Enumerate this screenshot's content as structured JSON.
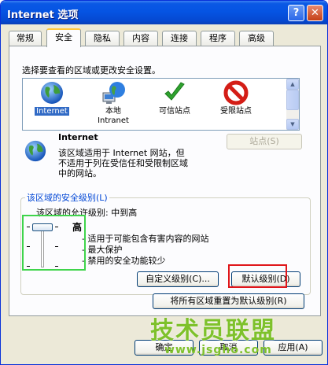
{
  "window": {
    "title": "Internet 选项",
    "help_glyph": "?",
    "close_glyph": "✕"
  },
  "tabs": [
    {
      "label": "常规",
      "active": false
    },
    {
      "label": "安全",
      "active": true
    },
    {
      "label": "隐私",
      "active": false
    },
    {
      "label": "内容",
      "active": false
    },
    {
      "label": "连接",
      "active": false
    },
    {
      "label": "程序",
      "active": false
    },
    {
      "label": "高级",
      "active": false
    }
  ],
  "security": {
    "instruction": "选择要查看的区域或更改安全设置。",
    "zones": [
      {
        "line1": "Internet",
        "line2": "",
        "icon": "globe-icon",
        "selected": true
      },
      {
        "line1": "本地",
        "line2": "Intranet",
        "icon": "local-intranet-icon",
        "selected": false
      },
      {
        "line1": "可信站点",
        "line2": "",
        "icon": "checkmark-icon",
        "selected": false
      },
      {
        "line1": "受限站点",
        "line2": "",
        "icon": "restricted-icon",
        "selected": false
      }
    ],
    "zone_title": "Internet",
    "zone_desc": [
      "该区域适用于 Internet 网站，但",
      "不适用于列在受信任和受限制区域",
      "中的网站。"
    ],
    "sites_button": "站点(S)",
    "group_title": "该区域的安全级别(L)",
    "allowed_level": "该区域的允许级别: 中到高",
    "level": "高",
    "bullets": [
      "适用于可能包含有害内容的网站",
      "最大保护",
      "禁用的安全功能较少"
    ],
    "custom_button": "自定义级别(C)...",
    "default_button": "默认级别(D)",
    "reset_all_button": "将所有区域重置为默认级别(R)"
  },
  "footer": {
    "ok": "确定",
    "cancel": "取消",
    "apply": "应用(A)"
  },
  "watermark": {
    "main": "技术员联盟",
    "url": "www.jsgho.com"
  },
  "colors": {
    "titlebar": "#0554e3",
    "selection": "#316ac5",
    "highlight_green": "#3fd44b",
    "highlight_red": "#e0161a",
    "watermark": "#7ec12b"
  }
}
